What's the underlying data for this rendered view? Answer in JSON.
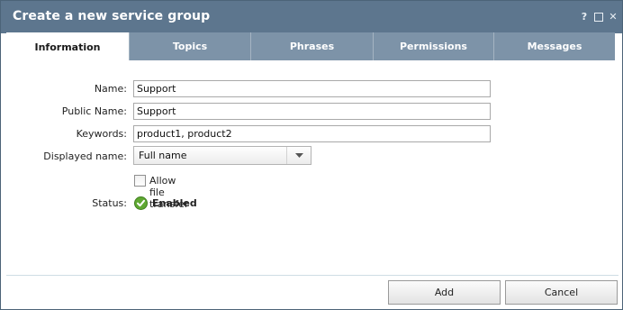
{
  "window": {
    "title": "Create a new service group",
    "controls": {
      "help": "?",
      "maximize_icon": "maximize-icon",
      "close": "✕"
    }
  },
  "tabs": [
    {
      "label": "Information",
      "active": true
    },
    {
      "label": "Topics",
      "active": false
    },
    {
      "label": "Phrases",
      "active": false
    },
    {
      "label": "Permissions",
      "active": false
    },
    {
      "label": "Messages",
      "active": false
    }
  ],
  "form": {
    "name": {
      "label": "Name:",
      "value": "Support"
    },
    "public_name": {
      "label": "Public Name:",
      "value": "Support"
    },
    "keywords": {
      "label": "Keywords:",
      "value": "product1, product2"
    },
    "displayed_name": {
      "label": "Displayed name:",
      "value": "Full name"
    },
    "allow_file_transfer": {
      "label": "Allow file transfer",
      "checked": false
    },
    "status": {
      "label": "Status:",
      "value": "Enabled",
      "icon": "check-circle-icon",
      "color": "#5fa832"
    }
  },
  "buttons": {
    "add": "Add",
    "cancel": "Cancel"
  },
  "colors": {
    "titlebar": "#5d768e",
    "tab": "#7d93a8",
    "active_tab": "#ffffff"
  }
}
